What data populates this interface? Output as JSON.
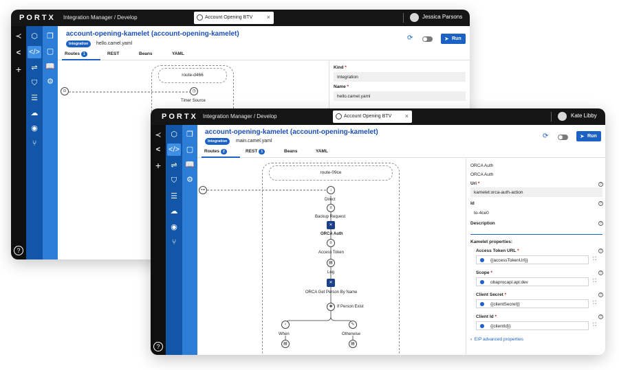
{
  "back": {
    "logo": "PORTX",
    "breadcrumb": "Integration Manager / Develop",
    "tab": "Account Opening BTV",
    "user": "Jessica Parsons",
    "title": "account-opening-kamelet (account-opening-kamelet)",
    "badge": "Integration",
    "file": "hello.camel.yaml",
    "run": "Run",
    "tabs": [
      {
        "label": "Routes",
        "count": "1"
      },
      {
        "label": "REST"
      },
      {
        "label": "Beans"
      },
      {
        "label": "YAML"
      }
    ],
    "route": "route-d466",
    "step": "Timer Source",
    "panel": {
      "kind_label": "Kind",
      "kind_value": "Integration",
      "name_label": "Name",
      "name_value": "hello.camel.yaml"
    }
  },
  "front": {
    "logo": "PORTX",
    "breadcrumb": "Integration Manager / Develop",
    "tab": "Account Opening BTV",
    "user": "Kate Libby",
    "title": "account-opening-kamelet (account-opening-kamelet)",
    "badge": "Integration",
    "file": "main.camel.yaml",
    "run": "Run",
    "tabs": [
      {
        "label": "Routes",
        "count": "2"
      },
      {
        "label": "REST",
        "count": "1"
      },
      {
        "label": "Beans"
      },
      {
        "label": "YAML"
      }
    ],
    "route": "route-09ce",
    "steps": [
      {
        "label": "Direct",
        "icon": "arrow-down-icon"
      },
      {
        "label": "Backup Request",
        "icon": "list-icon"
      },
      {
        "label": "ORCA Auth",
        "icon": "kamelet-icon"
      },
      {
        "label": "Access Token",
        "icon": "list-icon"
      },
      {
        "label": "Log",
        "icon": "log-icon"
      },
      {
        "label": "ORCA Get Person By Name",
        "icon": "kamelet-icon"
      }
    ],
    "choice": "If Person Exist",
    "branches": [
      {
        "label": "When",
        "icon": "bulb-icon"
      },
      {
        "label": "Otherwise",
        "icon": "pen-icon"
      }
    ],
    "panel": {
      "heading1": "ORCA Auth",
      "heading2": "ORCA Auth",
      "uri_label": "Uri",
      "uri_value": "kamelet:orca-auth-action",
      "id_label": "Id",
      "id_value": "to-4ce0",
      "desc_label": "Description",
      "kamelet_label": "Kamelet properties:",
      "props": [
        {
          "label": "Access Token URL",
          "value": "{{accessTokenUrl}}"
        },
        {
          "label": "Scope",
          "value": "obaprocapi:api:dev"
        },
        {
          "label": "Client Secret",
          "value": "{{clientSecret}}"
        },
        {
          "label": "Client Id",
          "value": "{{clientId}}"
        }
      ],
      "advanced": "EIP advanced properties"
    }
  }
}
